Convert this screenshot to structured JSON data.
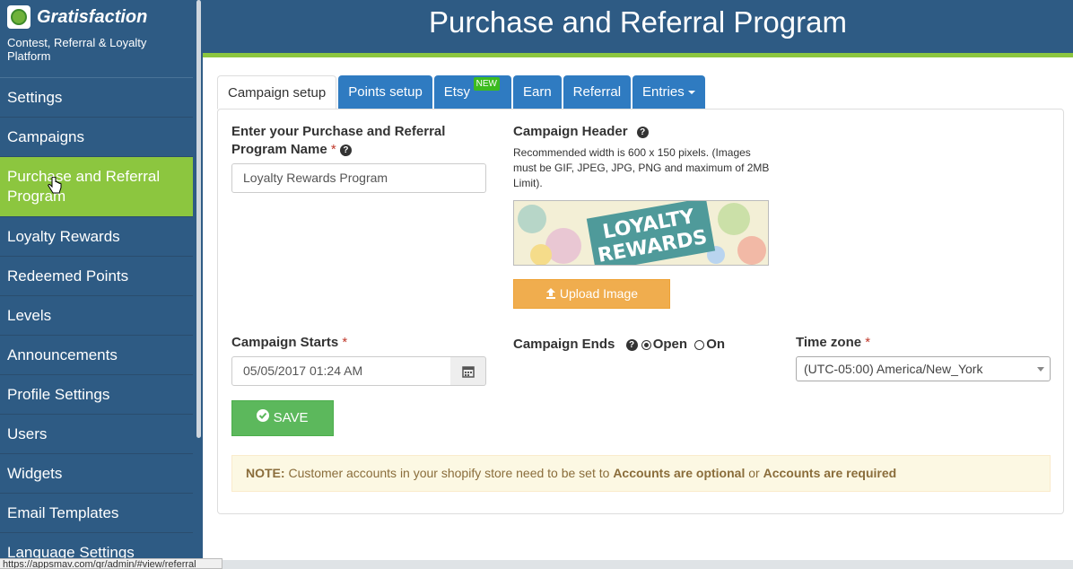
{
  "sidebar": {
    "brand": "Gratisfaction",
    "tagline": "Contest, Referral & Loyalty Platform",
    "items": [
      {
        "label": "Settings"
      },
      {
        "label": "Campaigns"
      },
      {
        "label": "Purchase and Referral Program"
      },
      {
        "label": "Loyalty Rewards"
      },
      {
        "label": "Redeemed Points"
      },
      {
        "label": "Levels"
      },
      {
        "label": "Announcements"
      },
      {
        "label": "Profile Settings"
      },
      {
        "label": "Users"
      },
      {
        "label": "Widgets"
      },
      {
        "label": "Email Templates"
      },
      {
        "label": "Language Settings"
      }
    ]
  },
  "header": {
    "title": "Purchase and Referral Program"
  },
  "tabs": [
    {
      "label": "Campaign setup"
    },
    {
      "label": "Points setup"
    },
    {
      "label": "Etsy",
      "badge": "NEW"
    },
    {
      "label": "Earn"
    },
    {
      "label": "Referral"
    },
    {
      "label": "Entries"
    }
  ],
  "form": {
    "name_label": "Enter your Purchase and Referral Program Name",
    "name_value": "Loyalty Rewards Program",
    "header_label": "Campaign Header",
    "header_hint": "Recommended width is 600 x 150 pixels. (Images must be GIF, JPEG, JPG, PNG and maximum of 2MB Limit).",
    "banner_text_1": "LOYALTY",
    "banner_text_2": "REWARDS",
    "upload_label": "Upload Image",
    "starts_label": "Campaign Starts",
    "starts_value": "05/05/2017 01:24 AM",
    "ends_label": "Campaign Ends",
    "ends_open": "Open",
    "ends_on": "On",
    "timezone_label": "Time zone",
    "timezone_value": "(UTC-05:00) America/New_York",
    "save_label": "SAVE",
    "required_mark": "*"
  },
  "note": {
    "prefix": "NOTE:",
    "text1": " Customer accounts in your shopify store need to be set to ",
    "bold1": "Accounts are optional",
    "text2": " or ",
    "bold2": "Accounts are required"
  },
  "statusbar": {
    "url": "https://appsmav.com/gr/admin/#view/referral"
  },
  "colors": {
    "sidebar": "#2e5b84",
    "accent": "#8cc63f",
    "tab": "#2f7bc1",
    "upload": "#f0ad4e",
    "save": "#5cb85c"
  }
}
